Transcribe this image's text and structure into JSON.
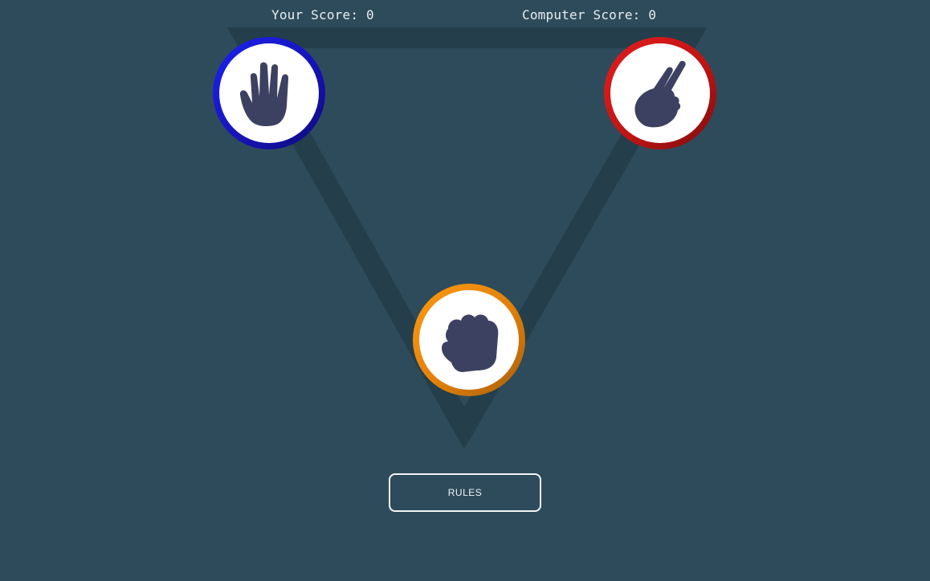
{
  "scoreboard": {
    "player": "Your Score: 0",
    "computer": "Computer Score: 0"
  },
  "choices": [
    {
      "id": "paper",
      "icon": "paper-hand-icon",
      "ring_color": "#1614b8"
    },
    {
      "id": "scissors",
      "icon": "scissors-hand-icon",
      "ring_color": "#c01414"
    },
    {
      "id": "rock",
      "icon": "rock-fist-icon",
      "ring_color": "#e0800a"
    }
  ],
  "rules_button": {
    "label": "RULES"
  },
  "colors": {
    "background": "#2e4b5b",
    "triangle": "#243e4b",
    "hand_icon": "#3d4161"
  }
}
